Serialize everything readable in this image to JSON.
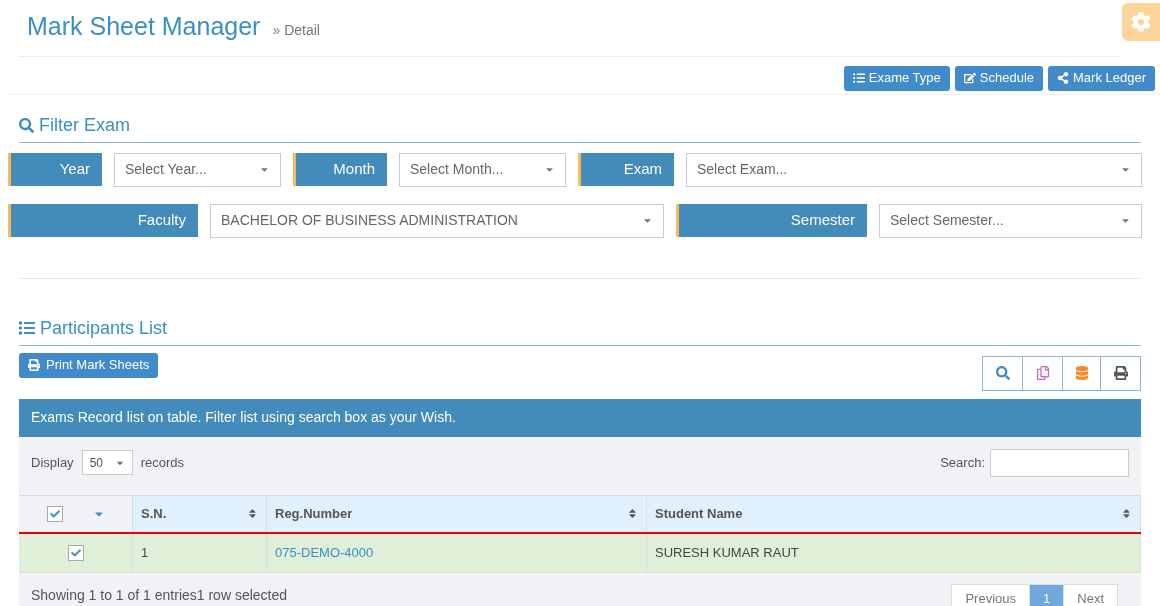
{
  "header": {
    "title": "Mark Sheet Manager",
    "breadcrumb": "» Detail"
  },
  "toolbar_buttons": [
    {
      "label": "Exame Type"
    },
    {
      "label": "Schedule"
    },
    {
      "label": "Mark Ledger"
    }
  ],
  "filter": {
    "title": "Filter Exam",
    "fields": [
      {
        "label": "Year",
        "placeholder": "Select Year..."
      },
      {
        "label": "Month",
        "placeholder": "Select Month..."
      },
      {
        "label": "Exam",
        "placeholder": "Select Exam..."
      },
      {
        "label": "Faculty",
        "value": "BACHELOR OF BUSINESS ADMINISTRATION"
      },
      {
        "label": "Semester",
        "placeholder": "Select Semester..."
      }
    ]
  },
  "participants": {
    "title": "Participants List",
    "print_button": "Print Mark Sheets",
    "info_bar": "Exams Record list on table. Filter list using search box as your Wish.",
    "display": {
      "label": "Display",
      "value": "50",
      "suffix": "records"
    },
    "search": {
      "label": "Search:"
    },
    "table": {
      "columns": [
        {
          "kind": "checkbox",
          "checked": true
        },
        {
          "kind": "text",
          "label": "S.N."
        },
        {
          "kind": "text",
          "label": "Reg.Number"
        },
        {
          "kind": "text",
          "label": "Student Name"
        }
      ],
      "rows": [
        {
          "selected": true,
          "cells": [
            {
              "kind": "checkbox",
              "checked": true
            },
            {
              "kind": "text",
              "text": "1"
            },
            {
              "kind": "link",
              "text": "075-DEMO-4000"
            },
            {
              "kind": "text",
              "text": "SURESH KUMAR RAUT"
            }
          ]
        }
      ]
    },
    "footer": "Showing 1 to 1 of 1 entries1 row selected",
    "pagination": [
      {
        "label": "Previous",
        "selected": false
      },
      {
        "label": "1",
        "selected": true
      },
      {
        "label": "Next",
        "selected": false
      }
    ]
  }
}
